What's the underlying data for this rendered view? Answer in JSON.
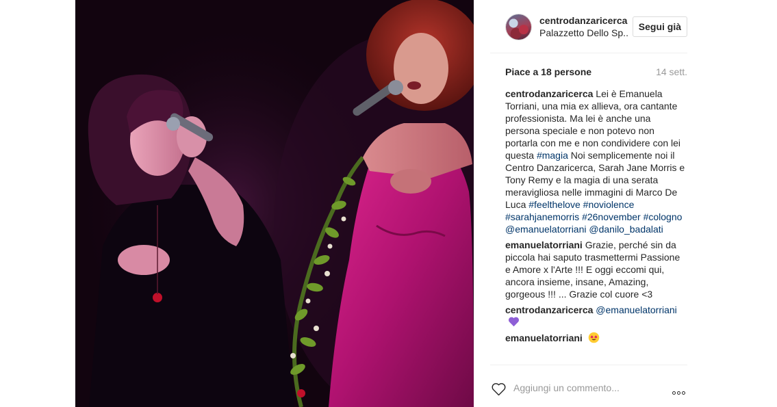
{
  "post": {
    "user": {
      "username": "centrodanzaricerca",
      "location": "Palazzetto Dello Sp..",
      "follow_label": "Segui già"
    },
    "likes_text": "Piace a 18 persone",
    "timestamp": "14 sett.",
    "caption": {
      "author": "centrodanzaricerca",
      "text_1": " Lei è Emanuela Torriani, una mia ex allieva, ora cantante professionista. Ma lei è anche una persona speciale e non potevo non portarla con me e non condividere con lei questa ",
      "tag_magia": "#magia",
      "text_2": " Noi semplicemente noi il Centro Danzaricerca, Sarah Jane Morris e Tony Remy e la magia di una serata meravigliosa nelle immagini di Marco De Luca ",
      "tag_feelthelove": "#feelthelove",
      "tag_noviolence": "#noviolence",
      "tag_sarahjanemorris": "#sarahjanemorris",
      "tag_26november": "#26november",
      "tag_cologno": "#cologno",
      "mention_emanuela": "@emanuelatorriani",
      "mention_danilo": "@danilo_badalati"
    },
    "comments": [
      {
        "author": "emanuelatorriani",
        "text": " Grazie, perché sin da piccola hai saputo trasmettermi Passione e Amore x l'Arte !!! E oggi eccomi qui, ancora insieme, insane, Amazing, gorgeous !!! ... Grazie col cuore <3"
      },
      {
        "author": "centrodanzaricerca",
        "mention": "@emanuelatorriani",
        "emoji": "purple-heart"
      },
      {
        "author": "emanuelatorriani",
        "emoji": "heart-eyes"
      }
    ],
    "comment_placeholder": "Aggiungi un commento...",
    "colors": {
      "tag": "#003569",
      "muted": "#999999",
      "text": "#262626",
      "border": "#efefef"
    },
    "icons": [
      "heart-icon",
      "more-options-icon"
    ]
  }
}
